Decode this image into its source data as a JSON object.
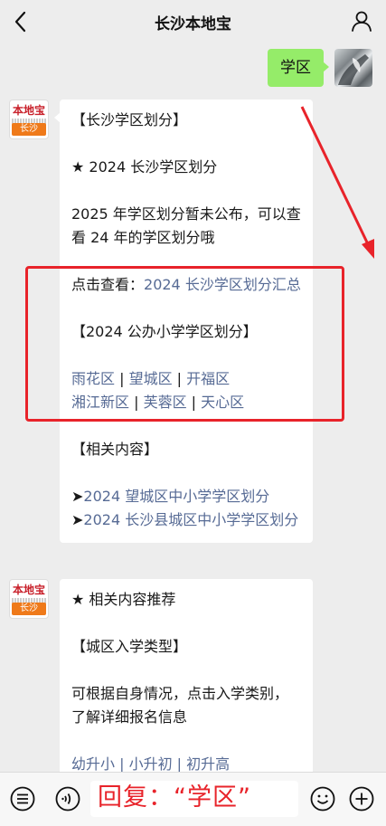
{
  "header": {
    "title": "长沙本地宝"
  },
  "user_message": {
    "text": "学区"
  },
  "bot_avatar": {
    "logo_text": "本地宝",
    "city_text": "长沙"
  },
  "message1": {
    "line1": "【长沙学区划分】",
    "line2": "★ 2024 长沙学区划分",
    "line3": "2025 年学区划分暂未公布，可以查看 24 年的学区划分哦",
    "line4_prefix": "点击查看：",
    "line4_link": "2024 长沙学区划分汇总",
    "line5": "【2024 公办小学学区划分】",
    "districts_row1": [
      "雨花区",
      "望城区",
      "开福区"
    ],
    "districts_row2": [
      "湘江新区",
      "芙蓉区",
      "天心区"
    ],
    "separator": " | ",
    "related_heading": "【相关内容】",
    "related_bullet": "➤",
    "related_links": [
      "2024 望城区中小学学区划分",
      "2024 长沙县城区中小学学区划分"
    ]
  },
  "message2": {
    "line1": "★ 相关内容推荐",
    "line2": "【城区入学类型】",
    "line3": "可根据自身情况，点击入学类别，了解详细报名信息",
    "partial_links": "幼升小 | 小升初 | 初升高"
  },
  "bottom_bar": {
    "reply_hint": "回复：“学区”"
  },
  "colors": {
    "link": "#576b95",
    "highlight_red": "#e8232a",
    "user_bubble": "#95ec69"
  }
}
